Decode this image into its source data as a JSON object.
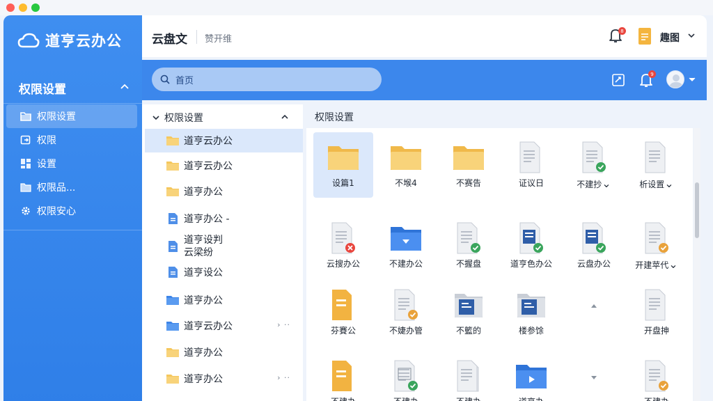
{
  "window": {
    "controls": [
      "close",
      "minimize",
      "maximize"
    ]
  },
  "brand": {
    "name": "道亨云办公",
    "icon": "cloud-icon"
  },
  "sidebar": {
    "heading": "权限设置",
    "items": [
      {
        "label": "权限设置",
        "icon": "folder-icon",
        "active": true
      },
      {
        "label": "权限",
        "icon": "exit-icon",
        "active": false
      },
      {
        "label": "设置",
        "icon": "grid-icon",
        "active": false
      },
      {
        "label": "权限品...",
        "icon": "folder-icon",
        "active": false
      },
      {
        "label": "权限安心",
        "icon": "gear-icon",
        "active": false
      }
    ]
  },
  "header": {
    "title": "云盘文",
    "subtitle": "赞开维",
    "notification_count": "8",
    "user_name": "趣图"
  },
  "toolbar": {
    "search_placeholder": "首页",
    "notification_count": "9"
  },
  "tree": {
    "heading": "权限设置",
    "items": [
      {
        "label": "道亨云办公",
        "icon": "folder-icon",
        "active": true
      },
      {
        "label": "道亨云办公",
        "icon": "folder-icon"
      },
      {
        "label": "道亨办公",
        "icon": "folder-icon"
      },
      {
        "label": "道亨办公 -",
        "icon": "document-icon"
      },
      {
        "label": "道亨设判 云梁纷",
        "icon": "document-icon"
      },
      {
        "label": "道亨设公",
        "icon": "document-icon"
      },
      {
        "label": "道亨办公",
        "icon": "blue-folder-icon"
      },
      {
        "label": "道亨云办公",
        "icon": "blue-folder-icon",
        "more": "› ··"
      },
      {
        "label": "道亨办公",
        "icon": "folder-icon"
      },
      {
        "label": "道亨办公",
        "icon": "folder-icon",
        "more": "› ··"
      }
    ]
  },
  "content": {
    "title": "权限设置",
    "tiles": [
      {
        "label": "设篇1",
        "kind": "folder",
        "selected": true
      },
      {
        "label": "不堠4",
        "kind": "folder"
      },
      {
        "label": "不赛告",
        "kind": "folder"
      },
      {
        "label": "证议日",
        "kind": "doc"
      },
      {
        "label": "不建抄",
        "kind": "doc-check",
        "caret": "⌄"
      },
      {
        "label": "析设置",
        "kind": "doc",
        "caret": "⌄"
      },
      {
        "label": "云搜办公",
        "kind": "doc-red"
      },
      {
        "label": "不建办公",
        "kind": "blue-folder"
      },
      {
        "label": "不握盘",
        "kind": "doc-check"
      },
      {
        "label": "道亨色办公",
        "kind": "word-check"
      },
      {
        "label": "云盘办公",
        "kind": "word-check"
      },
      {
        "label": "开建苹代",
        "kind": "doc-orange",
        "caret": "⌄"
      },
      {
        "label": "芬賽公",
        "kind": "orange-doc"
      },
      {
        "label": "不婕办管",
        "kind": "doc-orange"
      },
      {
        "label": "不籃的",
        "kind": "grey-folder-word"
      },
      {
        "label": "楼参馀",
        "kind": "grey-folder-word"
      },
      {
        "label": "",
        "kind": "caret-up"
      },
      {
        "label": "开盘抻",
        "kind": "doc"
      },
      {
        "label": "不建办",
        "kind": "orange-doc"
      },
      {
        "label": "不建办",
        "kind": "sheet-check"
      },
      {
        "label": "不建办",
        "kind": "doc-stack"
      },
      {
        "label": "道亨办",
        "kind": "blue-folder-play"
      },
      {
        "label": "",
        "kind": "caret-down"
      },
      {
        "label": "不建办",
        "kind": "doc-orange"
      }
    ]
  },
  "colors": {
    "primary": "#3c87ec",
    "sidebar": "#3f8ef0",
    "folder": "#f5c75d",
    "success": "#3aa55c",
    "warning": "#e9a23b",
    "danger": "#e9463e"
  }
}
